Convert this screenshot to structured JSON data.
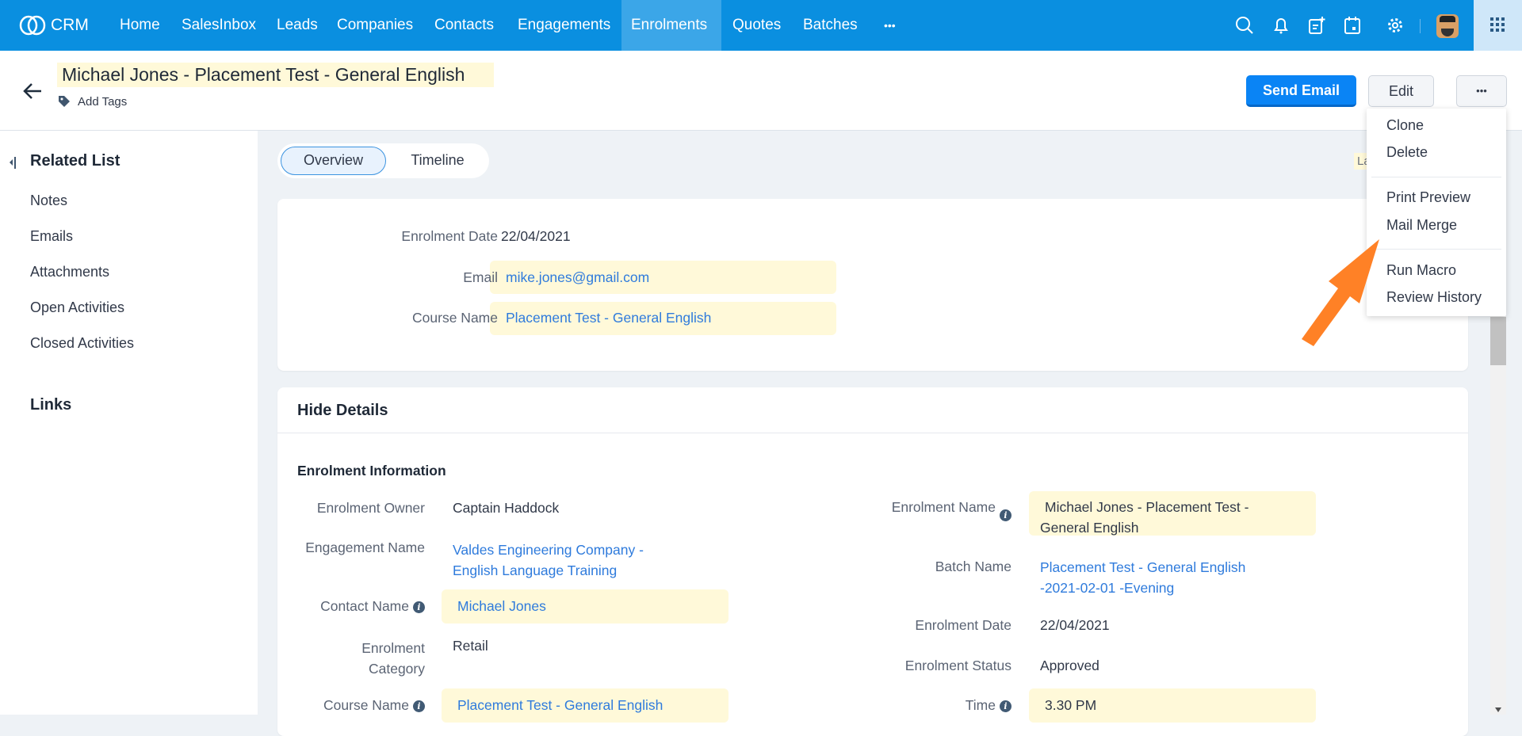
{
  "nav": {
    "logo": "CRM",
    "items": [
      "Home",
      "SalesInbox",
      "Leads",
      "Companies",
      "Contacts",
      "Engagements",
      "Enrolments",
      "Quotes",
      "Batches"
    ],
    "more": "•••",
    "active": "Enrolments",
    "color": "#0a8fe0"
  },
  "header": {
    "title": "Michael Jones - Placement Test - General English",
    "add_tags": "Add Tags",
    "send_email": "Send Email",
    "edit": "Edit",
    "more": "•••"
  },
  "sidebar": {
    "title": "Related List",
    "items": [
      "Notes",
      "Emails",
      "Attachments",
      "Open Activities",
      "Closed Activities"
    ],
    "links": "Links"
  },
  "tabs": {
    "overview": "Overview",
    "timeline": "Timeline",
    "last_update_partial": "La"
  },
  "summary": {
    "rows": [
      {
        "label": "Enrolment Date",
        "value": "22/04/2021"
      },
      {
        "label": "Email",
        "value": "mike.jones@gmail.com"
      },
      {
        "label": "Course Name",
        "value": "Placement Test - General English"
      }
    ]
  },
  "details": {
    "toggle": "Hide Details",
    "section": "Enrolment Information",
    "left": [
      {
        "label": "Enrolment Owner",
        "value": "Captain Haddock"
      },
      {
        "label": "Engagement Name",
        "value": "Valdes Engineering Company - English Language Training"
      },
      {
        "label": "Contact Name",
        "value": "Michael Jones"
      },
      {
        "label": "Enrolment Category",
        "value": "Retail"
      },
      {
        "label": "Course Name",
        "value": "Placement Test - General English"
      }
    ],
    "right": [
      {
        "label": "Enrolment Name",
        "value": "Michael Jones - Placement Test - General English"
      },
      {
        "label": "Batch Name",
        "value": "Placement Test - General English -2021-02-01 -Evening"
      },
      {
        "label": "Enrolment Date",
        "value": "22/04/2021"
      },
      {
        "label": "Enrolment Status",
        "value": "Approved"
      },
      {
        "label": "Time",
        "value": "3.30 PM"
      }
    ]
  },
  "menu": {
    "items": [
      "Clone",
      "Delete",
      "Print Preview",
      "Mail Merge",
      "Run Macro",
      "Review History"
    ]
  },
  "annotation": {
    "arrow_color": "#ff8126"
  }
}
